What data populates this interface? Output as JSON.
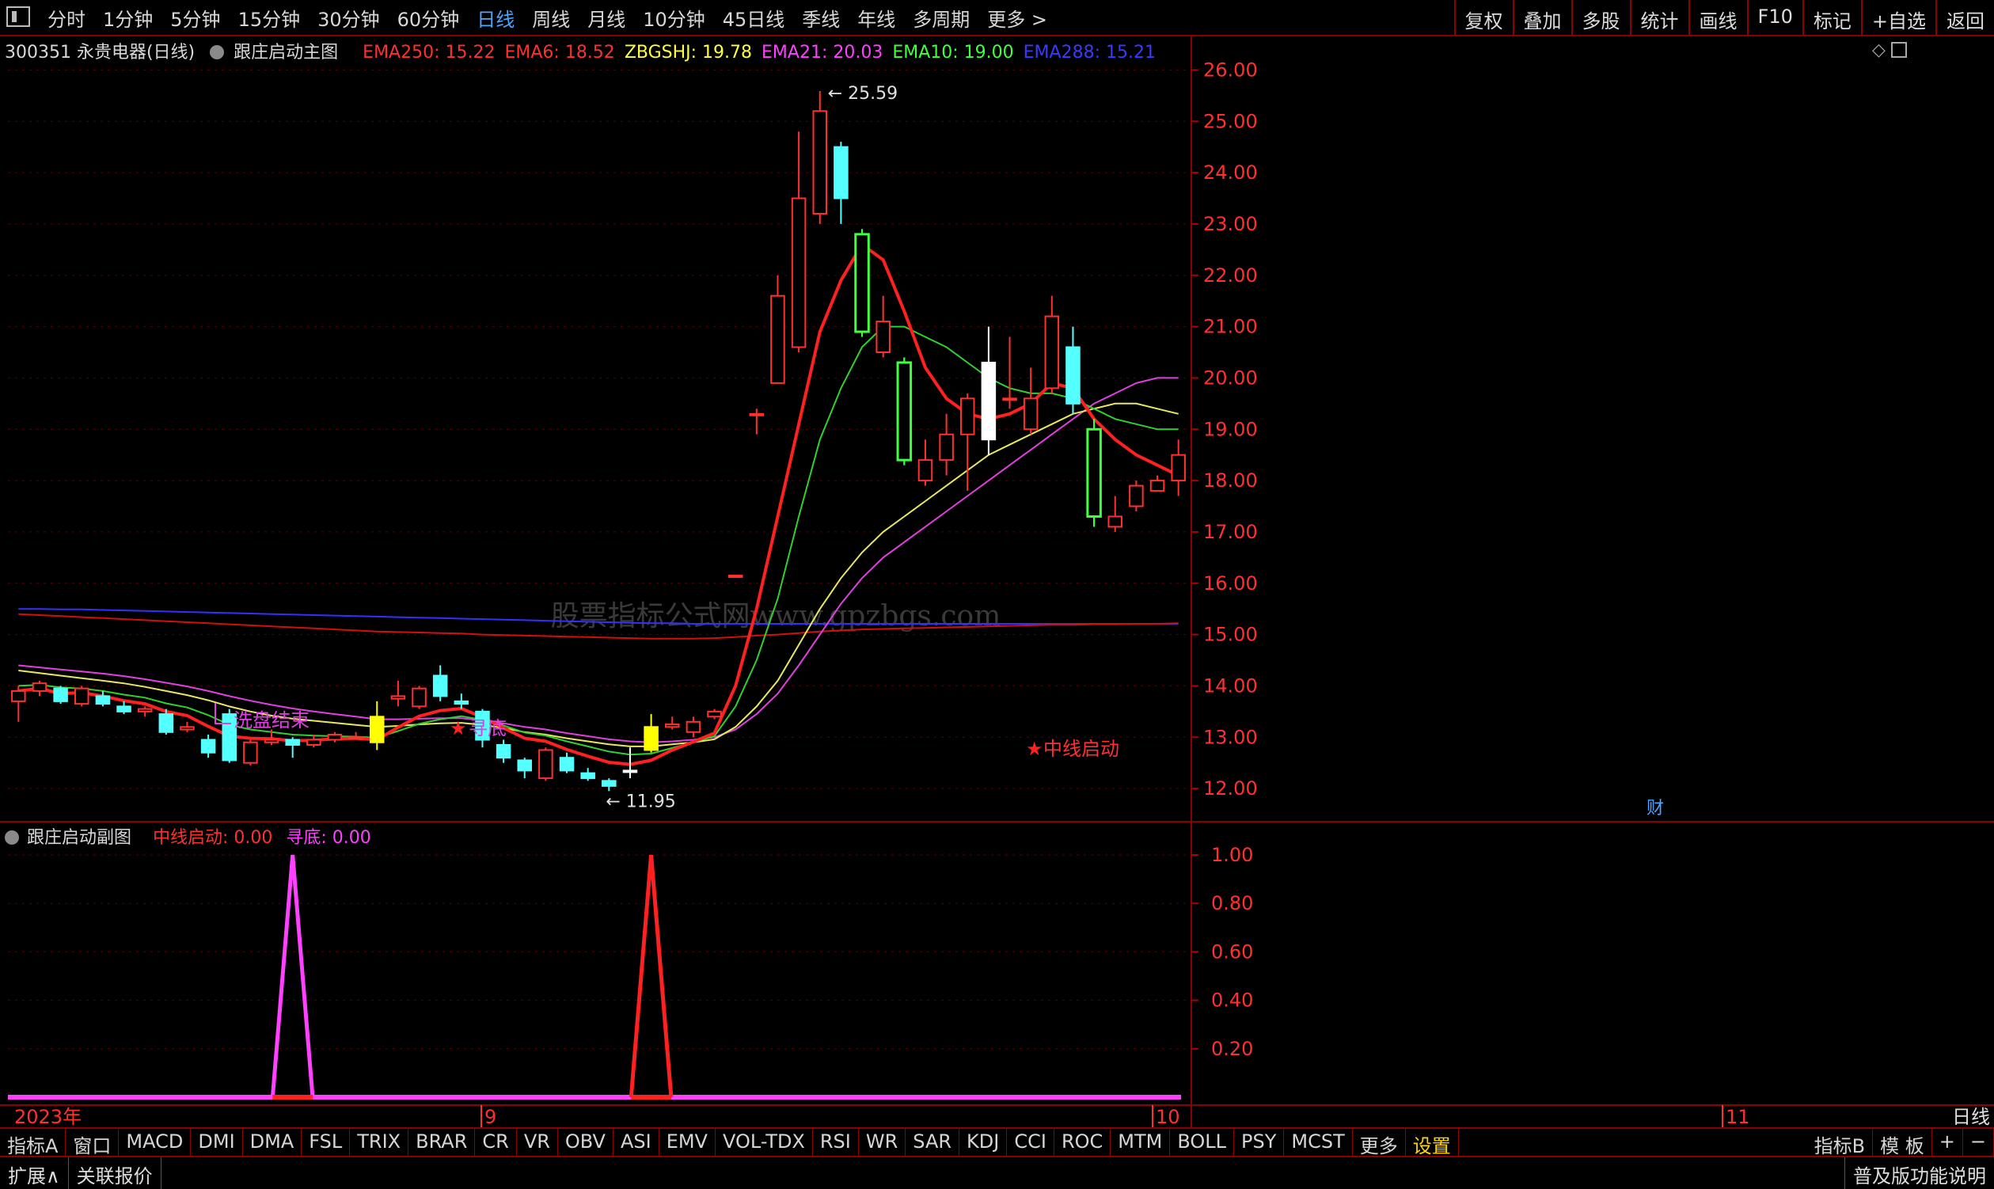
{
  "toolbar": {
    "periods": [
      "分时",
      "1分钟",
      "5分钟",
      "15分钟",
      "30分钟",
      "60分钟",
      "日线",
      "周线",
      "月线",
      "10分钟",
      "45日线",
      "季线",
      "年线",
      "多周期",
      "更多 >"
    ],
    "active_period": "日线",
    "tools": [
      "复权",
      "叠加",
      "多股",
      "统计",
      "画线",
      "F10",
      "标记",
      "+自选",
      "返回"
    ]
  },
  "main_info": {
    "stock": "300351 永贵电器(日线)",
    "indicator": "跟庄启动主图",
    "emas": [
      {
        "label": "EMA250: 15.22",
        "color": "#ff3030"
      },
      {
        "label": "EMA6: 18.52",
        "color": "#ff3030"
      },
      {
        "label": "ZBGSHJ: 19.78",
        "color": "#ffff40"
      },
      {
        "label": "EMA21: 20.03",
        "color": "#ff40ff"
      },
      {
        "label": "EMA10: 19.00",
        "color": "#40ff40"
      },
      {
        "label": "EMA288: 15.21",
        "color": "#3a3aff"
      }
    ]
  },
  "sub_info": {
    "indicator": "跟庄启动副图",
    "line1": "中线启动: 0.00",
    "line2": "寻底: 0.00"
  },
  "annotations": {
    "high": "25.59",
    "low": "11.95",
    "wash": "洗盘结束",
    "bottom": "寻底",
    "start": "中线启动",
    "cai": "财",
    "watermark": "股票指标公式网www.gpzbgs.com"
  },
  "axis": {
    "main_ticks": [
      "26.00",
      "25.00",
      "24.00",
      "23.00",
      "22.00",
      "21.00",
      "20.00",
      "19.00",
      "18.00",
      "17.00",
      "16.00",
      "15.00",
      "14.00",
      "13.00",
      "12.00"
    ],
    "sub_ticks": [
      "1.00",
      "0.80",
      "0.60",
      "0.40",
      "0.20"
    ],
    "date_labels": [
      "2023年",
      "9",
      "10",
      "11"
    ],
    "period_label": "日线"
  },
  "bottom_tabs": [
    "指标A",
    "窗口",
    "MACD",
    "DMI",
    "DMA",
    "FSL",
    "TRIX",
    "BRAR",
    "CR",
    "VR",
    "OBV",
    "ASI",
    "EMV",
    "VOL-TDX",
    "RSI",
    "WR",
    "SAR",
    "KDJ",
    "CCI",
    "ROC",
    "MTM",
    "BOLL",
    "PSY",
    "MCST",
    "更多",
    "设置"
  ],
  "bottom_right": [
    "指标B",
    "模 板",
    "+",
    "−"
  ],
  "status": {
    "left1": "扩展∧",
    "left2": "关联报价",
    "right": "普及版功能说明"
  },
  "chart_data": {
    "type": "candlestick",
    "ylim": [
      11.4,
      26.5
    ],
    "sub_ylim": [
      0,
      1.0
    ],
    "candles": [
      {
        "o": 13.7,
        "c": 13.9,
        "h": 14.0,
        "l": 13.3
      },
      {
        "o": 13.9,
        "c": 14.05,
        "h": 14.1,
        "l": 13.8
      },
      {
        "o": 13.95,
        "c": 13.7,
        "h": 14.0,
        "l": 13.65
      },
      {
        "o": 13.65,
        "c": 13.95,
        "h": 14.0,
        "l": 13.6
      },
      {
        "o": 13.8,
        "c": 13.65,
        "h": 13.9,
        "l": 13.6
      },
      {
        "o": 13.6,
        "c": 13.5,
        "h": 13.7,
        "l": 13.45
      },
      {
        "o": 13.5,
        "c": 13.55,
        "h": 13.6,
        "l": 13.4
      },
      {
        "o": 13.45,
        "c": 13.1,
        "h": 13.55,
        "l": 13.05
      },
      {
        "o": 13.15,
        "c": 13.2,
        "h": 13.3,
        "l": 13.1
      },
      {
        "o": 12.95,
        "c": 12.7,
        "h": 13.05,
        "l": 12.6
      },
      {
        "o": 13.45,
        "c": 12.55,
        "h": 13.55,
        "l": 12.5
      },
      {
        "o": 12.5,
        "c": 12.9,
        "h": 12.95,
        "l": 12.45
      },
      {
        "o": 12.9,
        "c": 12.95,
        "h": 13.15,
        "l": 12.85
      },
      {
        "o": 12.95,
        "c": 12.85,
        "h": 13.0,
        "l": 12.6
      },
      {
        "o": 12.85,
        "c": 12.95,
        "h": 13.05,
        "l": 12.8
      },
      {
        "o": 12.95,
        "c": 13.05,
        "h": 13.1,
        "l": 12.9
      },
      {
        "o": 13.0,
        "c": 13.0,
        "h": 13.1,
        "l": 12.95
      },
      {
        "o": 13.4,
        "c": 12.9,
        "h": 13.7,
        "l": 12.75
      },
      {
        "o": 13.75,
        "c": 13.8,
        "h": 14.1,
        "l": 13.6
      },
      {
        "o": 13.6,
        "c": 13.95,
        "h": 14.0,
        "l": 13.55
      },
      {
        "o": 14.2,
        "c": 13.8,
        "h": 14.4,
        "l": 13.7
      },
      {
        "o": 13.7,
        "c": 13.65,
        "h": 13.85,
        "l": 13.55
      },
      {
        "o": 13.5,
        "c": 12.95,
        "h": 13.55,
        "l": 12.8
      },
      {
        "o": 12.85,
        "c": 12.6,
        "h": 12.95,
        "l": 12.5
      },
      {
        "o": 12.55,
        "c": 12.35,
        "h": 12.6,
        "l": 12.2
      },
      {
        "o": 12.2,
        "c": 12.75,
        "h": 12.8,
        "l": 12.15
      },
      {
        "o": 12.6,
        "c": 12.35,
        "h": 12.7,
        "l": 12.3
      },
      {
        "o": 12.3,
        "c": 12.2,
        "h": 12.4,
        "l": 12.15
      },
      {
        "o": 12.15,
        "c": 12.05,
        "h": 12.2,
        "l": 11.95
      },
      {
        "o": 12.35,
        "c": 12.35,
        "h": 12.8,
        "l": 12.2
      },
      {
        "o": 13.2,
        "c": 12.75,
        "h": 13.45,
        "l": 12.7
      },
      {
        "o": 13.2,
        "c": 13.25,
        "h": 13.4,
        "l": 13.15
      },
      {
        "o": 13.1,
        "c": 13.3,
        "h": 13.4,
        "l": 13.0
      },
      {
        "o": 13.4,
        "c": 13.5,
        "h": 13.55,
        "l": 13.35
      },
      {
        "o": 16.15,
        "c": 16.15,
        "h": 16.15,
        "l": 16.15
      },
      {
        "o": 19.3,
        "c": 19.3,
        "h": 19.4,
        "l": 18.9
      },
      {
        "o": 19.9,
        "c": 21.6,
        "h": 22.0,
        "l": 19.9
      },
      {
        "o": 20.6,
        "c": 23.5,
        "h": 24.8,
        "l": 20.5
      },
      {
        "o": 23.2,
        "c": 25.2,
        "h": 25.59,
        "l": 23.0
      },
      {
        "o": 24.5,
        "c": 23.5,
        "h": 24.6,
        "l": 23.0
      },
      {
        "o": 22.8,
        "c": 20.9,
        "h": 22.9,
        "l": 20.8
      },
      {
        "o": 20.5,
        "c": 21.1,
        "h": 21.6,
        "l": 20.4
      },
      {
        "o": 20.3,
        "c": 18.4,
        "h": 20.4,
        "l": 18.3
      },
      {
        "o": 18.0,
        "c": 18.4,
        "h": 18.8,
        "l": 17.9
      },
      {
        "o": 18.4,
        "c": 18.9,
        "h": 19.3,
        "l": 18.1
      },
      {
        "o": 18.9,
        "c": 19.6,
        "h": 19.7,
        "l": 17.8
      },
      {
        "o": 20.3,
        "c": 18.8,
        "h": 21.0,
        "l": 18.5
      },
      {
        "o": 19.6,
        "c": 19.6,
        "h": 20.8,
        "l": 19.4
      },
      {
        "o": 19.0,
        "c": 19.6,
        "h": 20.2,
        "l": 18.9
      },
      {
        "o": 19.8,
        "c": 21.2,
        "h": 21.6,
        "l": 19.7
      },
      {
        "o": 20.6,
        "c": 19.5,
        "h": 21.0,
        "l": 19.3
      },
      {
        "o": 19.0,
        "c": 17.3,
        "h": 19.2,
        "l": 17.1
      },
      {
        "o": 17.1,
        "c": 17.3,
        "h": 17.7,
        "l": 17.0
      },
      {
        "o": 17.5,
        "c": 17.9,
        "h": 18.0,
        "l": 17.4
      },
      {
        "o": 17.8,
        "c": 18.0,
        "h": 18.1,
        "l": 17.8
      },
      {
        "o": 18.0,
        "c": 18.5,
        "h": 18.8,
        "l": 17.7
      }
    ],
    "special_candles": {
      "17": "yellow",
      "29": "white",
      "30": "yellow",
      "46": "white"
    },
    "lines": {
      "ema6": [
        13.9,
        13.95,
        13.85,
        13.87,
        13.8,
        13.71,
        13.65,
        13.5,
        13.42,
        13.21,
        13.02,
        12.98,
        12.97,
        12.93,
        12.94,
        12.97,
        12.98,
        12.95,
        13.19,
        13.41,
        13.52,
        13.56,
        13.39,
        13.18,
        12.98,
        12.92,
        12.76,
        12.63,
        12.51,
        12.47,
        12.55,
        12.75,
        12.91,
        13.08,
        14.0,
        15.5,
        17.3,
        19.1,
        20.9,
        21.9,
        22.6,
        22.3,
        21.3,
        20.2,
        19.6,
        19.3,
        19.2,
        19.3,
        19.5,
        19.9,
        19.8,
        19.2,
        18.8,
        18.5,
        18.3,
        18.1
      ],
      "ema10": [
        14.0,
        14.02,
        13.97,
        13.95,
        13.9,
        13.83,
        13.77,
        13.66,
        13.58,
        13.43,
        13.24,
        13.15,
        13.1,
        13.05,
        13.03,
        13.02,
        13.01,
        12.99,
        13.12,
        13.26,
        13.35,
        13.41,
        13.34,
        13.23,
        13.09,
        13.03,
        12.92,
        12.82,
        12.72,
        12.66,
        12.68,
        12.79,
        12.9,
        13.02,
        13.6,
        14.5,
        15.7,
        17.3,
        18.8,
        19.8,
        20.6,
        21.0,
        21.0,
        20.8,
        20.6,
        20.3,
        20.0,
        19.8,
        19.7,
        19.7,
        19.6,
        19.4,
        19.2,
        19.1,
        19.0,
        19.0
      ],
      "zbgshj": [
        14.3,
        14.25,
        14.2,
        14.15,
        14.1,
        14.05,
        13.98,
        13.9,
        13.82,
        13.72,
        13.6,
        13.5,
        13.42,
        13.36,
        13.32,
        13.28,
        13.24,
        13.2,
        13.22,
        13.25,
        13.27,
        13.28,
        13.24,
        13.18,
        13.1,
        13.05,
        12.98,
        12.92,
        12.86,
        12.82,
        12.82,
        12.86,
        12.9,
        12.96,
        13.2,
        13.6,
        14.1,
        14.8,
        15.5,
        16.1,
        16.6,
        17.0,
        17.3,
        17.6,
        17.9,
        18.2,
        18.5,
        18.7,
        18.9,
        19.1,
        19.3,
        19.4,
        19.5,
        19.5,
        19.4,
        19.3
      ],
      "ema21": [
        14.4,
        14.36,
        14.32,
        14.28,
        14.24,
        14.19,
        14.13,
        14.06,
        13.99,
        13.9,
        13.8,
        13.71,
        13.63,
        13.56,
        13.5,
        13.45,
        13.4,
        13.35,
        13.35,
        13.36,
        13.37,
        13.37,
        13.33,
        13.27,
        13.2,
        13.15,
        13.08,
        13.02,
        12.96,
        12.92,
        12.9,
        12.92,
        12.95,
        13.0,
        13.15,
        13.45,
        13.85,
        14.4,
        15.0,
        15.6,
        16.1,
        16.5,
        16.8,
        17.1,
        17.4,
        17.7,
        18.0,
        18.3,
        18.6,
        18.9,
        19.2,
        19.5,
        19.7,
        19.9,
        20.0,
        20.0
      ],
      "ema250": [
        15.4,
        15.38,
        15.36,
        15.34,
        15.32,
        15.3,
        15.28,
        15.26,
        15.24,
        15.22,
        15.2,
        15.18,
        15.16,
        15.14,
        15.12,
        15.1,
        15.08,
        15.06,
        15.05,
        15.04,
        15.03,
        15.02,
        15.0,
        14.99,
        14.98,
        14.97,
        14.96,
        14.95,
        14.94,
        14.93,
        14.92,
        14.92,
        14.92,
        14.93,
        14.95,
        14.98,
        15.0,
        15.03,
        15.06,
        15.08,
        15.1,
        15.11,
        15.12,
        15.13,
        15.14,
        15.15,
        15.16,
        15.17,
        15.18,
        15.19,
        15.19,
        15.2,
        15.2,
        15.21,
        15.21,
        15.22
      ],
      "ema288": [
        15.5,
        15.5,
        15.49,
        15.49,
        15.48,
        15.47,
        15.46,
        15.45,
        15.44,
        15.43,
        15.42,
        15.41,
        15.4,
        15.39,
        15.38,
        15.37,
        15.36,
        15.35,
        15.34,
        15.33,
        15.32,
        15.31,
        15.3,
        15.29,
        15.28,
        15.27,
        15.26,
        15.25,
        15.24,
        15.23,
        15.22,
        15.22,
        15.21,
        15.21,
        15.21,
        15.21,
        15.21,
        15.21,
        15.21,
        15.21,
        15.21,
        15.21,
        15.21,
        15.21,
        15.21,
        15.21,
        15.21,
        15.21,
        15.21,
        15.21,
        15.21,
        15.21,
        15.21,
        15.21,
        15.21,
        15.21
      ]
    },
    "signals": {
      "xundi": {
        "index": 13,
        "value": 1.0,
        "color": "#ff40ff"
      },
      "zhongxian": {
        "index": 30,
        "value": 1.0,
        "color": "#ff2020"
      }
    }
  }
}
